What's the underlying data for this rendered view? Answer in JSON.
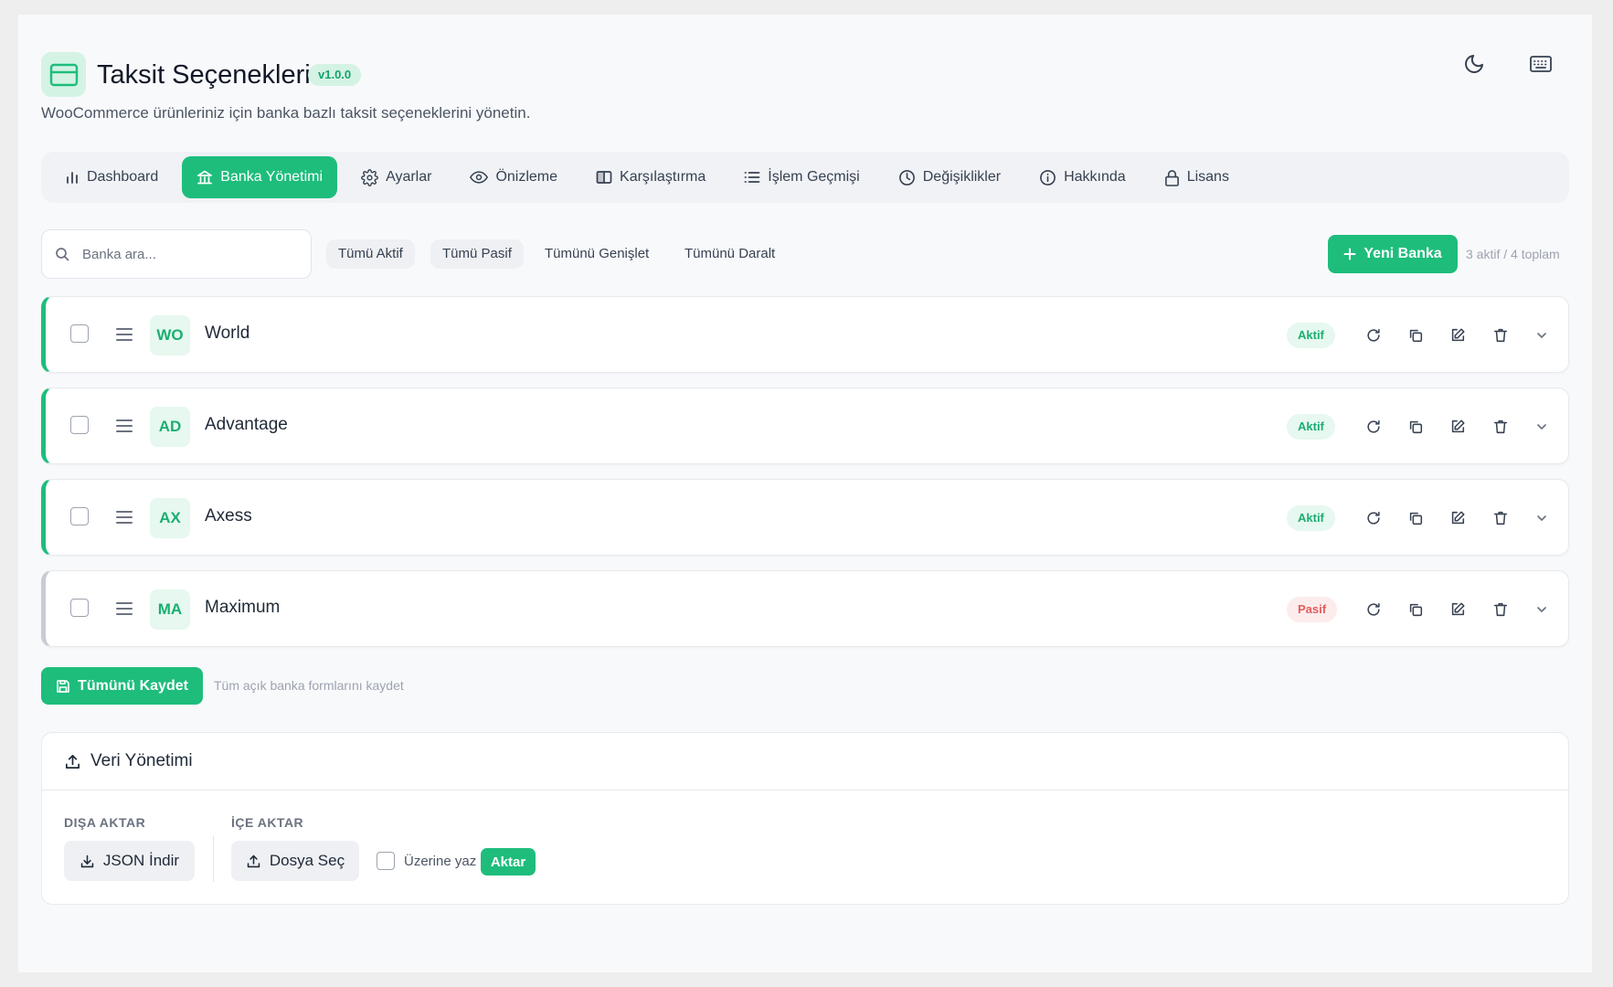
{
  "header": {
    "title": "Taksit Seçenekleri",
    "version": "v1.0.0",
    "subtitle": "WooCommerce ürünleriniz için banka bazlı taksit seçeneklerini yönetin.",
    "icon": "credit-card-icon",
    "actions": [
      "moon-icon",
      "keyboard-icon"
    ]
  },
  "tabs": [
    {
      "label": "Dashboard",
      "icon": "bar-chart-icon",
      "active": false
    },
    {
      "label": "Banka Yönetimi",
      "icon": "bank-icon",
      "active": true
    },
    {
      "label": "Ayarlar",
      "icon": "gear-icon",
      "active": false
    },
    {
      "label": "Önizleme",
      "icon": "eye-icon",
      "active": false
    },
    {
      "label": "Karşılaştırma",
      "icon": "columns-icon",
      "active": false
    },
    {
      "label": "İşlem Geçmişi",
      "icon": "list-icon",
      "active": false
    },
    {
      "label": "Değişiklikler",
      "icon": "clock-icon",
      "active": false
    },
    {
      "label": "Hakkında",
      "icon": "info-icon",
      "active": false
    },
    {
      "label": "Lisans",
      "icon": "lock-icon",
      "active": false
    }
  ],
  "toolbar": {
    "search_placeholder": "Banka ara...",
    "all_active": "Tümü Aktif",
    "all_passive": "Tümü Pasif",
    "expand_all": "Tümünü Genişlet",
    "collapse_all": "Tümünü Daralt",
    "new_bank": "Yeni Banka",
    "count": "3 aktif / 4 toplam"
  },
  "banks": [
    {
      "abbr": "WO",
      "name": "World",
      "status": "Aktif",
      "active": true
    },
    {
      "abbr": "AD",
      "name": "Advantage",
      "status": "Aktif",
      "active": true
    },
    {
      "abbr": "AX",
      "name": "Axess",
      "status": "Aktif",
      "active": true
    },
    {
      "abbr": "MA",
      "name": "Maximum",
      "status": "Pasif",
      "active": false
    }
  ],
  "save": {
    "label": "Tümünü Kaydet",
    "hint": "Tüm açık banka formlarını kaydet"
  },
  "data_management": {
    "title": "Veri Yönetimi",
    "export_label": "DIŞA AKTAR",
    "export_button": "JSON İndir",
    "import_label": "İÇE AKTAR",
    "import_button": "Dosya Seç",
    "overwrite_label": "Üzerine yaz",
    "import_submit": "Aktar"
  },
  "colors": {
    "accent": "#1ebd7c",
    "accent_soft": "#d4f3e4",
    "danger": "#e25d5d"
  }
}
